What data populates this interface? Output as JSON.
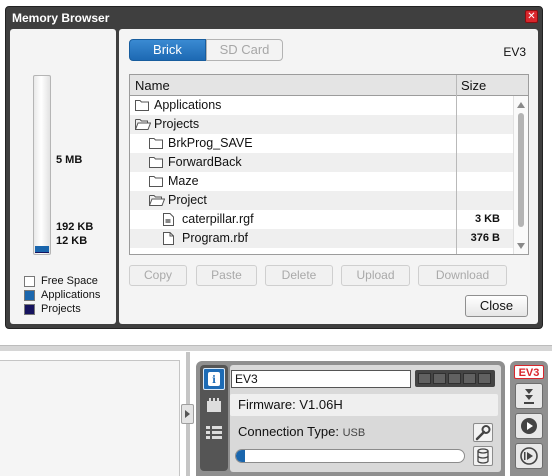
{
  "dialog": {
    "title": "Memory Browser",
    "close_glyph": "✕",
    "memory": {
      "total_label": "5 MB",
      "used_label": "192 KB",
      "projects_label": "12 KB",
      "applications_fraction": 0.038,
      "projects_fraction": 0.0024
    },
    "legend": [
      {
        "label": "Free Space",
        "color": "#ffffff"
      },
      {
        "label": "Applications",
        "color": "#1a66ad"
      },
      {
        "label": "Projects",
        "color": "#16135e"
      }
    ],
    "tabs": {
      "brick": "Brick",
      "sd_card": "SD Card"
    },
    "brick_name": "EV3",
    "columns": {
      "name": "Name",
      "size": "Size"
    },
    "files": [
      {
        "name": "Applications",
        "icon": "folder-closed-icon",
        "size": "",
        "level": 0
      },
      {
        "name": "Projects",
        "icon": "folder-open-icon",
        "size": "",
        "level": 0
      },
      {
        "name": "BrkProg_SAVE",
        "icon": "folder-closed-icon",
        "size": "",
        "level": 1
      },
      {
        "name": "ForwardBack",
        "icon": "folder-closed-icon",
        "size": "",
        "level": 1
      },
      {
        "name": "Maze",
        "icon": "folder-closed-icon",
        "size": "",
        "level": 1
      },
      {
        "name": "Project",
        "icon": "folder-open-icon",
        "size": "",
        "level": 1
      },
      {
        "name": "caterpillar.rgf",
        "icon": "graphic-file-icon",
        "size": "3 KB",
        "level": 2
      },
      {
        "name": "Program.rbf",
        "icon": "file-icon",
        "size": "376 B",
        "level": 2
      }
    ],
    "actions": {
      "copy": "Copy",
      "paste": "Paste",
      "delete": "Delete",
      "upload": "Upload",
      "download": "Download"
    },
    "close_button": "Close"
  },
  "hardware_page": {
    "brick_name_value": "EV3",
    "firmware": "Firmware: V1.06H",
    "connection_label": "Connection Type:",
    "connection_value": "USB",
    "memory_used_fraction": 0.038,
    "ev3_badge": "EV3"
  }
}
